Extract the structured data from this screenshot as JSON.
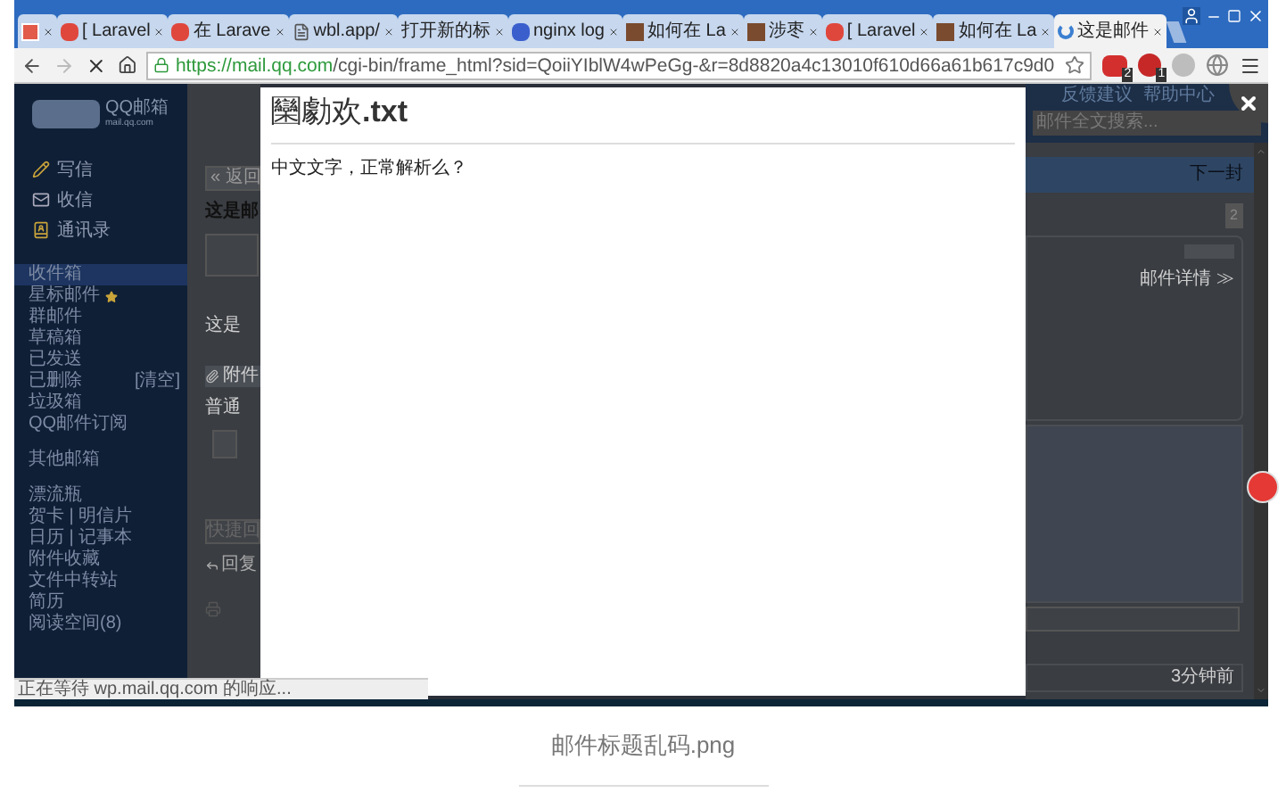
{
  "browser": {
    "tabs": [
      {
        "kind": "red",
        "selected": false
      },
      {
        "kind": "laravel",
        "label": "[ Laravel",
        "selected": false
      },
      {
        "kind": "laravel",
        "label": "在 Larave",
        "selected": false
      },
      {
        "kind": "page",
        "label": "wbl.app/",
        "selected": false
      },
      {
        "kind": "none",
        "label": "打开新的标",
        "selected": false
      },
      {
        "kind": "paw",
        "label": "nginx log",
        "selected": false
      },
      {
        "kind": "photo",
        "label": "如何在 La",
        "selected": false
      },
      {
        "kind": "photo",
        "label": "涉枣",
        "selected": false
      },
      {
        "kind": "laravel",
        "label": "[ Laravel",
        "selected": false
      },
      {
        "kind": "photo",
        "label": "如何在 La",
        "selected": false
      },
      {
        "kind": "spinner",
        "label": "这是邮件",
        "selected": true
      }
    ],
    "url_host": "https://mail.qq.com",
    "url_path": "/cgi-bin/frame_html?sid=QoiiYIblW4wPeGg-&r=8d8820a4c13010f610d66a61b617c9d0",
    "extensions": [
      {
        "kind": "red-box",
        "badge": "2"
      },
      {
        "kind": "abp",
        "badge": "1"
      },
      {
        "kind": "grey"
      },
      {
        "kind": "globe"
      }
    ],
    "status": "正在等待 wp.mail.qq.com 的响应..."
  },
  "mail": {
    "logo_brand": "QQ邮箱",
    "logo_domain": "mail.qq.com",
    "nav": [
      {
        "kind": "write",
        "label": "写信"
      },
      {
        "kind": "inbox",
        "label": "收信"
      },
      {
        "kind": "contacts",
        "label": "通讯录"
      }
    ],
    "folders": [
      {
        "label": "收件箱",
        "selected": true
      },
      {
        "label": "星标邮件",
        "selected": false,
        "star": true
      },
      {
        "label": "群邮件",
        "selected": false
      },
      {
        "label": "草稿箱",
        "selected": false
      },
      {
        "label": "已发送",
        "selected": false
      },
      {
        "label": "已删除",
        "selected": false,
        "action": "[清空]"
      },
      {
        "label": "垃圾箱",
        "selected": false
      },
      {
        "label": "QQ邮件订阅",
        "selected": false
      }
    ],
    "other_groups": [
      [
        "其他邮箱"
      ],
      [
        "漂流瓶",
        "贺卡 | 明信片",
        "日历 | 记事本",
        "附件收藏",
        "文件中转站",
        "简历",
        "阅读空间(8)"
      ]
    ],
    "back_button": "« 返回",
    "subject_fragment": "这是邮",
    "body_fragment": "这是",
    "attachment_fragment": "附件",
    "attachment_kind_fragment": "普通",
    "quick_reply_fragment": "快捷回",
    "reply_fragment": "回复",
    "header_links": [
      "反馈建议",
      "帮助中心"
    ],
    "search_placeholder": "邮件全文搜索...",
    "next_button": "下一封",
    "count_badge": "2",
    "details_link": "邮件详情 ≫",
    "time": "3分钟前"
  },
  "dialog": {
    "title_garbled": "圞勮欢",
    "title_ext": ".txt",
    "body": "中文文字，正常解析么？"
  },
  "caption": "邮件标题乱码.png"
}
